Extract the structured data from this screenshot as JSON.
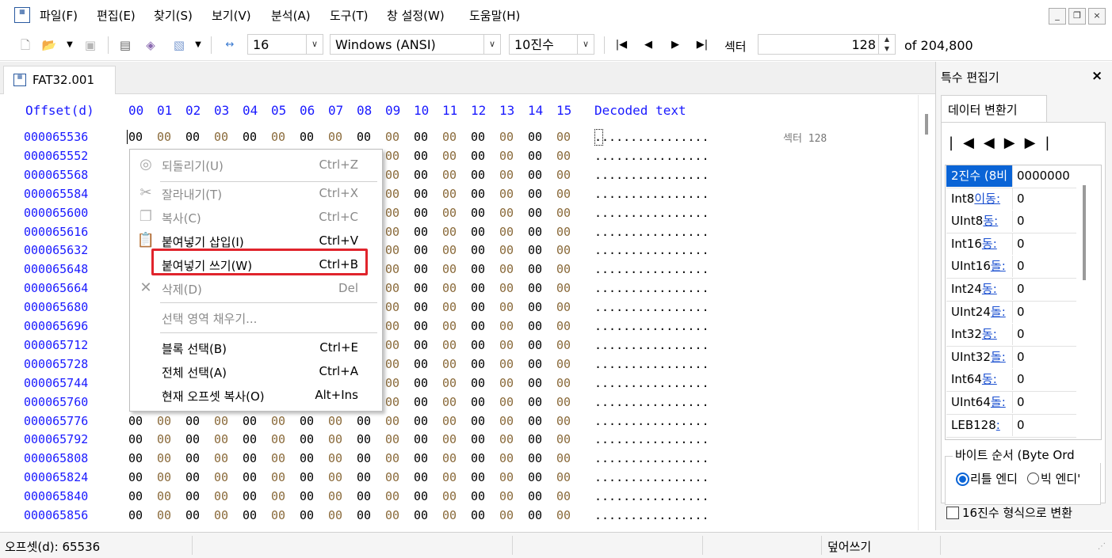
{
  "menubar": {
    "items": [
      "파일(F)",
      "편집(E)",
      "찾기(S)",
      "보기(V)",
      "분석(A)",
      "도구(T)",
      "창 설정(W)",
      "도움말(H)"
    ],
    "window_buttons": [
      "_",
      "❐",
      "×"
    ]
  },
  "toolbar": {
    "bytes_per_row": "16",
    "charset": "Windows (ANSI)",
    "number_base": "10진수",
    "sector_label": "섹터",
    "sector_value": "128",
    "sector_total": "of 204,800"
  },
  "tab": {
    "label": "FAT32.001"
  },
  "hex": {
    "offset_header": "Offset(d)",
    "columns": [
      "00",
      "01",
      "02",
      "03",
      "04",
      "05",
      "06",
      "07",
      "08",
      "09",
      "10",
      "11",
      "12",
      "13",
      "14",
      "15"
    ],
    "decoded_header": "Decoded text",
    "sector_note": "섹터 128",
    "byte_value": "00",
    "decoded_row": "................",
    "offsets": [
      "000065536",
      "000065552",
      "000065568",
      "000065584",
      "000065600",
      "000065616",
      "000065632",
      "000065648",
      "000065664",
      "000065680",
      "000065696",
      "000065712",
      "000065728",
      "000065744",
      "000065760",
      "000065776",
      "000065792",
      "000065808",
      "000065824",
      "000065840",
      "000065856"
    ]
  },
  "context_menu": {
    "items": [
      {
        "label": "되돌리기(U)",
        "shortcut": "Ctrl+Z",
        "enabled": false,
        "icon": "undo-icon"
      },
      {
        "label": "잘라내기(T)",
        "shortcut": "Ctrl+X",
        "enabled": false,
        "icon": "scissors-icon"
      },
      {
        "label": "복사(C)",
        "shortcut": "Ctrl+C",
        "enabled": false,
        "icon": "copy-icon"
      },
      {
        "label": "붙여넣기 삽입(I)",
        "shortcut": "Ctrl+V",
        "enabled": true,
        "icon": "paste-icon"
      },
      {
        "label": "붙여넣기 쓰기(W)",
        "shortcut": "Ctrl+B",
        "enabled": true,
        "highlighted": true
      },
      {
        "label": "삭제(D)",
        "shortcut": "Del",
        "enabled": false,
        "icon": "delete-x-icon"
      },
      {
        "label": "선택 영역 채우기...",
        "shortcut": "",
        "enabled": false
      },
      {
        "label": "블록 선택(B)",
        "shortcut": "Ctrl+E",
        "enabled": true
      },
      {
        "label": "전체 선택(A)",
        "shortcut": "Ctrl+A",
        "enabled": true
      },
      {
        "label": "현재 오프셋 복사(O)",
        "shortcut": "Alt+Ins",
        "enabled": true
      }
    ],
    "highlight_color": "#e0242c"
  },
  "side_panel": {
    "title": "특수 편집기",
    "close": "×",
    "tab": "데이터 변환기",
    "rows": [
      {
        "label": "2진수 (8비",
        "value": "0000000"
      },
      {
        "label": "Int8",
        "link": "이동:",
        "value": "0"
      },
      {
        "label": "UInt8",
        "link": "동:",
        "value": "0"
      },
      {
        "label": "Int16",
        "link": "동:",
        "value": "0"
      },
      {
        "label": "UInt16",
        "link": "돌:",
        "value": "0"
      },
      {
        "label": "Int24",
        "link": "동:",
        "value": "0"
      },
      {
        "label": "UInt24",
        "link": "돌:",
        "value": "0"
      },
      {
        "label": "Int32",
        "link": "동:",
        "value": "0"
      },
      {
        "label": "UInt32",
        "link": "돌:",
        "value": "0"
      },
      {
        "label": "Int64",
        "link": "동:",
        "value": "0"
      },
      {
        "label": "UInt64",
        "link": "돌:",
        "value": "0"
      },
      {
        "label": "LEB128",
        "link": ":",
        "value": "0"
      }
    ],
    "byte_order_label": "바이트 순서 (Byte Ord",
    "little_endian": "리틀 엔디",
    "big_endian": "빅 엔디'",
    "hex_format": "16진수 형식으로 변환"
  },
  "status": {
    "offset": "오프셋(d): 65536",
    "mode": "덮어쓰기"
  },
  "colors": {
    "offset_blue": "#1a1aff",
    "selection_blue": "#0a64d6"
  }
}
